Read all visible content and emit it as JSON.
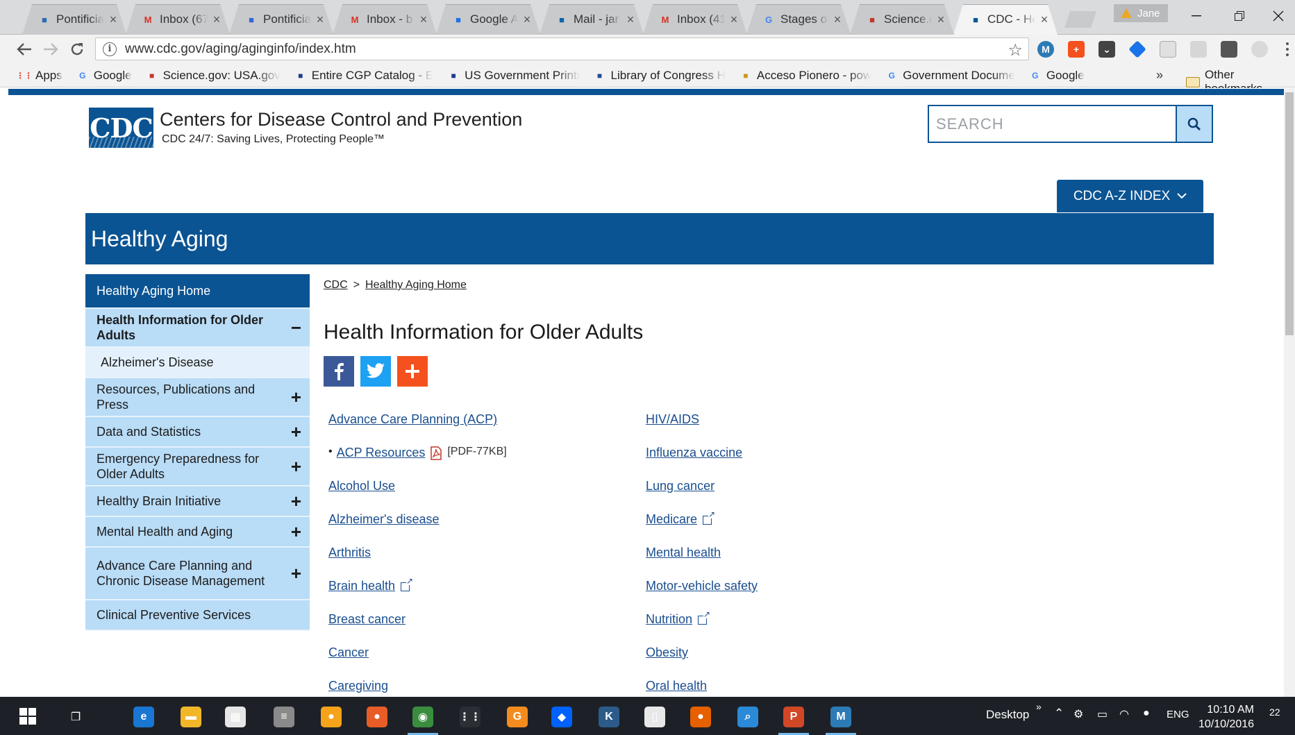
{
  "browser": {
    "tabs": [
      {
        "title": "Pontificia",
        "icon": "pontificia-icon",
        "color": "#2b6cb0"
      },
      {
        "title": "Inbox (67",
        "icon": "gmail-icon",
        "color": "#d93025"
      },
      {
        "title": "Pontificia",
        "icon": "calendar-icon",
        "color": "#3367d6"
      },
      {
        "title": "Inbox - b",
        "icon": "gmail-icon",
        "color": "#d93025"
      },
      {
        "title": "Google A",
        "icon": "google-analytics-icon",
        "color": "#1a73e8"
      },
      {
        "title": "Mail - jar",
        "icon": "outlook-icon",
        "color": "#0a64ad"
      },
      {
        "title": "Inbox (41",
        "icon": "gmail-icon",
        "color": "#d93025"
      },
      {
        "title": "Stages of",
        "icon": "google-icon",
        "color": "#4285f4"
      },
      {
        "title": "Science.g",
        "icon": "science-gov-icon",
        "color": "#c0392b"
      },
      {
        "title": "CDC - He",
        "icon": "cdc-icon",
        "color": "#0b5493",
        "active": true
      }
    ],
    "profile": "Jane",
    "url": "www.cdc.gov/aging/aginginfo/index.htm",
    "bookmarks": [
      {
        "title": "Apps",
        "icon": "apps-grid-icon",
        "color": "#e04a3f"
      },
      {
        "title": "Google",
        "icon": "google-icon",
        "color": "#4285f4"
      },
      {
        "title": "Science.gov: USA.gov",
        "icon": "science-gov-icon",
        "color": "#c0392b"
      },
      {
        "title": "Entire CGP Catalog - E",
        "icon": "gpo-icon",
        "color": "#1f3c8c"
      },
      {
        "title": "US Government Printi",
        "icon": "gpo-icon",
        "color": "#1f3c8c"
      },
      {
        "title": "Library of Congress H",
        "icon": "library-of-congress-icon",
        "color": "#1d4f91"
      },
      {
        "title": "Acceso Pionero - pow",
        "icon": "acceso-icon",
        "color": "#c49a1c"
      },
      {
        "title": "Government Docume",
        "icon": "google-icon",
        "color": "#4285f4"
      },
      {
        "title": "Google",
        "icon": "google-icon",
        "color": "#4285f4"
      }
    ],
    "bookmarks_more": "»",
    "other_bookmarks": "Other bookmarks"
  },
  "site": {
    "logo_text": "CDC",
    "agency_name": "Centers for Disease Control and Prevention",
    "tagline": "CDC 24/7: Saving Lives, Protecting People™",
    "search_placeholder": "SEARCH",
    "az_index": "CDC A-Z INDEX",
    "banner_title": "Healthy Aging",
    "brand_color": "#0b5493"
  },
  "leftnav": [
    {
      "label": "Healthy Aging Home",
      "kind": "home"
    },
    {
      "label": "Health Information for Older Adults",
      "kind": "expanded",
      "toggle": "−"
    },
    {
      "label": "Alzheimer's Disease",
      "kind": "sub"
    },
    {
      "label": "Resources, Publications and Press",
      "kind": "item",
      "toggle": "+"
    },
    {
      "label": "Data and Statistics",
      "kind": "item",
      "toggle": "+"
    },
    {
      "label": "Emergency Preparedness for Older Adults",
      "kind": "item",
      "toggle": "+"
    },
    {
      "label": "Healthy Brain Initiative",
      "kind": "item",
      "toggle": "+"
    },
    {
      "label": "Mental Health and Aging",
      "kind": "item",
      "toggle": "+"
    },
    {
      "label": "Advance Care Planning and Chronic Disease Management",
      "kind": "item",
      "toggle": "+"
    },
    {
      "label": "Clinical Preventive Services",
      "kind": "item"
    }
  ],
  "breadcrumb": {
    "root": "CDC",
    "separator": ">",
    "current": "Healthy Aging Home"
  },
  "page_title": "Health Information for Older Adults",
  "share": [
    {
      "name": "facebook",
      "glyph": "f",
      "color": "#3b5998"
    },
    {
      "name": "twitter",
      "glyph": "t",
      "color": "#1da1f2"
    },
    {
      "name": "addthis",
      "glyph": "+",
      "color": "#f4511e"
    }
  ],
  "topics_left": [
    {
      "label": "Advance Care Planning (ACP)"
    },
    {
      "label": "ACP Resources",
      "bullet": "•",
      "pdf": true,
      "pdf_size": "[PDF-77KB]"
    },
    {
      "label": "Alcohol Use"
    },
    {
      "label": "Alzheimer's disease"
    },
    {
      "label": "Arthritis"
    },
    {
      "label": "Brain health",
      "external": true
    },
    {
      "label": "Breast cancer"
    },
    {
      "label": "Cancer"
    },
    {
      "label": "Caregiving"
    }
  ],
  "topics_right": [
    {
      "label": "HIV/AIDS"
    },
    {
      "label": "Influenza vaccine"
    },
    {
      "label": "Lung cancer"
    },
    {
      "label": "Medicare",
      "external": true
    },
    {
      "label": "Mental health"
    },
    {
      "label": "Motor-vehicle safety"
    },
    {
      "label": "Nutrition",
      "external": true
    },
    {
      "label": "Obesity"
    },
    {
      "label": "Oral health"
    }
  ],
  "taskbar": {
    "apps": [
      {
        "name": "task-view",
        "glyph": "❐",
        "color": "#1d2127"
      },
      {
        "name": "edge",
        "glyph": "e",
        "color": "#1976d2"
      },
      {
        "name": "file-explorer",
        "glyph": "▬",
        "color": "#f2b728"
      },
      {
        "name": "store",
        "glyph": "▦",
        "color": "#e6e6e6"
      },
      {
        "name": "notepad",
        "glyph": "≡",
        "color": "#8a8a8a"
      },
      {
        "name": "chrome-canary",
        "glyph": "●",
        "color": "#f4a31b"
      },
      {
        "name": "firefox-color",
        "glyph": "●",
        "color": "#e85d27"
      },
      {
        "name": "chrome",
        "glyph": "◉",
        "color": "#3a8d3e",
        "running": true
      },
      {
        "name": "apps-launcher",
        "glyph": "⋮⋮",
        "color": "#2a2e35"
      },
      {
        "name": "sticky",
        "glyph": "G",
        "color": "#f28c1e"
      },
      {
        "name": "dropbox",
        "glyph": "◆",
        "color": "#0061fe"
      },
      {
        "name": "kindle",
        "glyph": "K",
        "color": "#2c5b8a"
      },
      {
        "name": "files",
        "glyph": "▯",
        "color": "#e8e8e8"
      },
      {
        "name": "firefox",
        "glyph": "●",
        "color": "#e66000"
      },
      {
        "name": "search-tool",
        "glyph": "⌕",
        "color": "#2b8ad8"
      },
      {
        "name": "powerpoint",
        "glyph": "P",
        "color": "#d24726",
        "running": true
      },
      {
        "name": "mailbird",
        "glyph": "M",
        "color": "#2c7bb6",
        "running": true
      }
    ],
    "desktop_label": "Desktop",
    "language": "ENG",
    "time": "10:10 AM",
    "date": "10/10/2016",
    "notification_count": "22"
  }
}
